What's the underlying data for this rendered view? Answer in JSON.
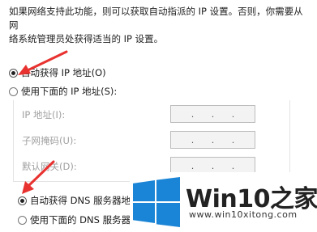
{
  "description": {
    "line1": "如果网络支持此功能，则可以获取自动指派的 IP 设置。否则，你需要从网",
    "line2": "络系统管理员处获得适当的 IP 设置。"
  },
  "ip_section": {
    "auto_label": "自动获得 IP 地址(O)",
    "auto_selected": true,
    "manual_label": "使用下面的 IP 地址(S):",
    "fields": [
      {
        "label": "IP 地址(I):",
        "value": ".   .   ."
      },
      {
        "label": "子网掩码(U):",
        "value": ".   .   ."
      },
      {
        "label": "默认网关(D):",
        "value": ".   .   ."
      }
    ]
  },
  "dns_section": {
    "auto_label": "自动获得 DNS 服务器地址(B)",
    "auto_selected": true,
    "manual_label": "使用下面的 DNS 服务器地址(E):"
  },
  "watermark": {
    "brand": "Win10",
    "brand_suffix": "之家",
    "site": "www.win10xitong.com"
  },
  "colors": {
    "arrow": "#e8322f",
    "logo_blue": "#1a84d6"
  }
}
